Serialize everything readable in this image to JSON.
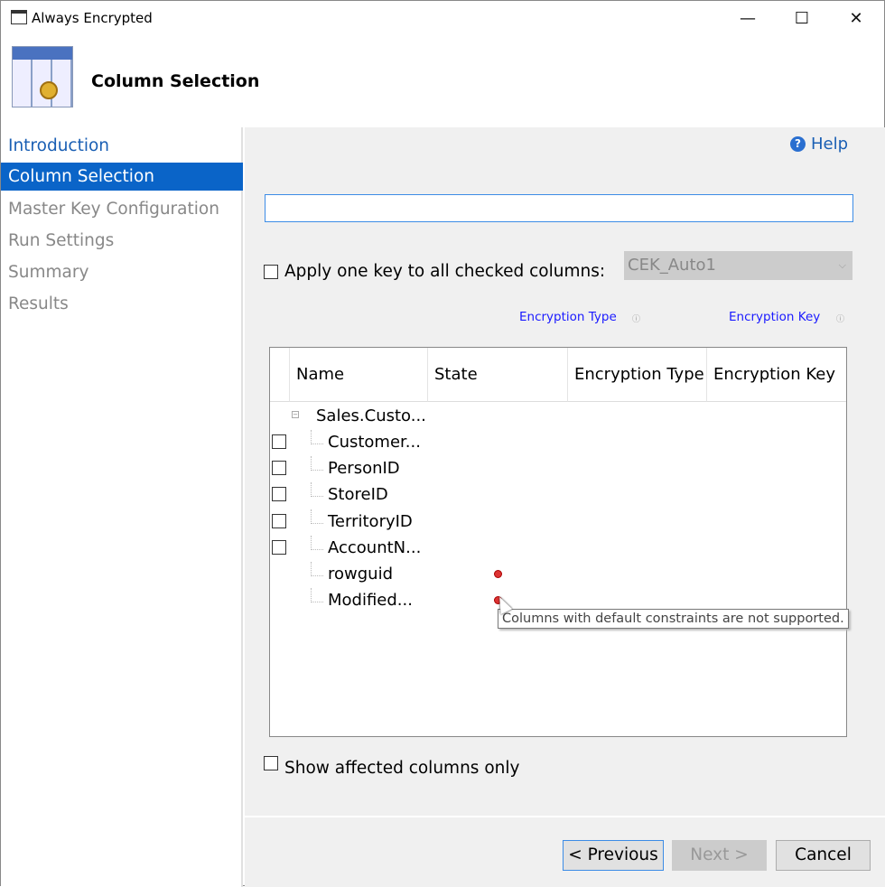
{
  "window": {
    "title": "Always Encrypted",
    "minimize": "—",
    "maximize": "☐",
    "close": "✕"
  },
  "header": {
    "title": "Column Selection",
    "icon": "table-key-icon"
  },
  "nav": {
    "items": [
      {
        "label": "Introduction",
        "state": "link"
      },
      {
        "label": "Column Selection",
        "state": "active"
      },
      {
        "label": "Master Key Configuration",
        "state": "disabled"
      },
      {
        "label": "Run Settings",
        "state": "disabled"
      },
      {
        "label": "Summary",
        "state": "disabled"
      },
      {
        "label": "Results",
        "state": "disabled"
      }
    ]
  },
  "main": {
    "help": "Help",
    "search_value": "",
    "apply_key_label": "Apply one key to all checked columns:",
    "apply_key_checked": false,
    "key_combo": "CEK_Auto1",
    "encryption_type_link": "Encryption Type",
    "encryption_key_link": "Encryption Key",
    "grid": {
      "headers": [
        "Name",
        "State",
        "Encryption Type",
        "Encryption Key"
      ],
      "table": "Sales.Custo...",
      "rows": [
        {
          "name": "Customer...",
          "checkbox": true,
          "error": false
        },
        {
          "name": "PersonID",
          "checkbox": true,
          "error": false
        },
        {
          "name": "StoreID",
          "checkbox": true,
          "error": false
        },
        {
          "name": "TerritoryID",
          "checkbox": true,
          "error": false
        },
        {
          "name": "AccountN...",
          "checkbox": true,
          "error": false
        },
        {
          "name": "rowguid",
          "checkbox": false,
          "error": true
        },
        {
          "name": "Modified...",
          "checkbox": false,
          "error": true
        }
      ]
    },
    "tooltip": "Columns with default constraints are not supported.",
    "show_affected_label": "Show affected columns only"
  },
  "buttons": {
    "previous": "< Previous",
    "next": "Next >",
    "cancel": "Cancel"
  },
  "colors": {
    "accent": "#0a64c8",
    "link": "#1a5fb4",
    "error": "#dd3333"
  }
}
